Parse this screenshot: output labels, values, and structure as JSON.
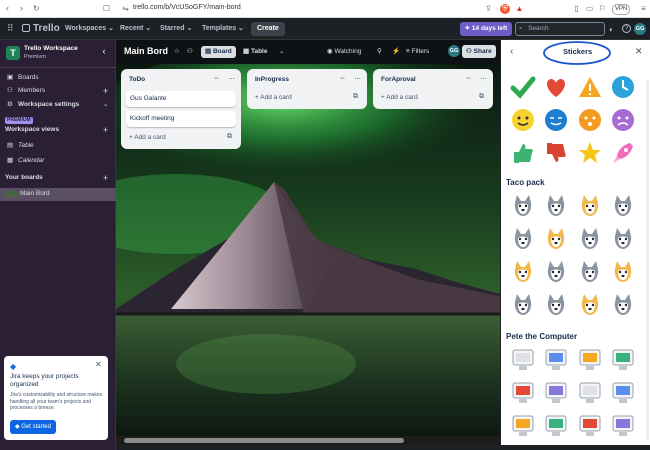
{
  "browser": {
    "url": "trello.com/b/VcUSoGFY/main-bord",
    "vpn": "VPN"
  },
  "header": {
    "logo": "Trello",
    "menus": [
      "Workspaces",
      "Recent",
      "Starred",
      "Templates"
    ],
    "create": "Create",
    "trial": "14 days left",
    "search_placeholder": "Search",
    "avatar": "GG"
  },
  "sidebar": {
    "workspace_initial": "T",
    "workspace_name": "Trello Workspace",
    "workspace_plan": "Premium",
    "items": [
      {
        "label": "Boards",
        "icon": "board-icon"
      },
      {
        "label": "Members",
        "icon": "members-icon"
      },
      {
        "label": "Workspace settings",
        "icon": "gear-icon"
      }
    ],
    "premium_badge": "PREMIUM",
    "views_title": "Workspace views",
    "views": [
      "Table",
      "Calendar"
    ],
    "your_boards": "Your boards",
    "boards": [
      "Main Bord"
    ]
  },
  "boardbar": {
    "title": "Main Bord",
    "views": [
      "Board",
      "Table"
    ],
    "watching": "Watching",
    "filters": "Filters",
    "avatar": "GG",
    "share": "Share"
  },
  "lists": [
    {
      "title": "ToDo",
      "cards": [
        "Gus Galante",
        "Kickoff meeting"
      ],
      "add": "Add a card"
    },
    {
      "title": "InProgress",
      "cards": [],
      "add": "Add a card"
    },
    {
      "title": "ForAproval",
      "cards": [],
      "add": "Add a card"
    }
  ],
  "panel": {
    "title": "Stickers",
    "sections": [
      "Taco pack",
      "Pete the Computer"
    ]
  },
  "jira": {
    "title": "Jira keeps your projects organized",
    "body": "Jira's customizability and structure makes handling all your team's projects and processes a breeze.",
    "cta": "Get started"
  },
  "colors": {
    "accent": "#0c66e4",
    "header": "#1d2125",
    "sidebar": "#2b1f35",
    "trial": "#6e5dc6"
  }
}
